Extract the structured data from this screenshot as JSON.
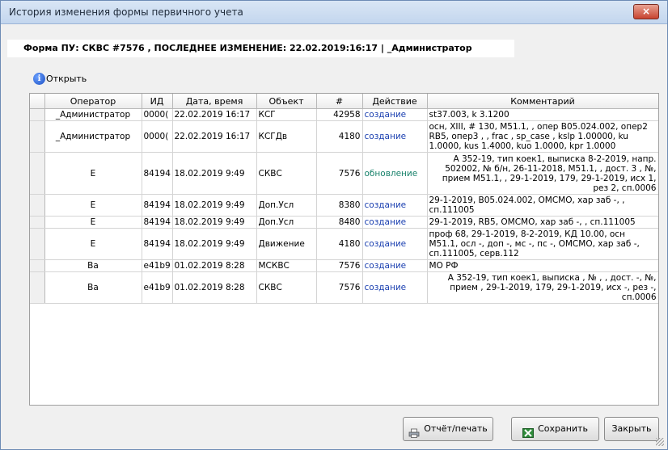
{
  "window": {
    "title": "История изменения формы первичного учета",
    "close_label": "×"
  },
  "form_header": "Форма ПУ: СКВС  #7576 , ПОСЛЕДНЕЕ ИЗМЕНЕНИЕ: 22.02.2019:16:17 | _Администратор",
  "toolbar": {
    "open_label": "Открыть",
    "open_icon": "info-icon"
  },
  "table": {
    "columns": [
      "",
      "Оператор",
      "ИД",
      "Дата, время",
      "Объект",
      "#",
      "Действие",
      "Комментарий"
    ],
    "rows": [
      {
        "operator": "_Администратор",
        "id": "0000(",
        "datetime": "22.02.2019 16:17",
        "object": "КСГ",
        "num": "42958",
        "action": "создание",
        "comment": "st37.003, k 3.1200"
      },
      {
        "operator": "_Администратор",
        "id": "0000(",
        "datetime": "22.02.2019 16:17",
        "object": "КСГДв",
        "num": "4180",
        "action": "создание",
        "comment": "осн, XIII, # 130, M51.1, , опер B05.024.002, опер2 RB5, опер3 , , frac , sp_case , kslp 1.00000, ku 1.0000, kus 1.4000, kuo 1.0000, kpr 1.0000"
      },
      {
        "operator": "Е",
        "id": "84194",
        "datetime": "18.02.2019 9:49",
        "object": "СКВС",
        "num": "7576",
        "action": "обновление",
        "comment": "А 352-19, тип коек1, выписка 8-2-2019, напр. 502002, № б/н, 26-11-2018, M51.1, , дост. 3 , №, прием M51.1, , 29-1-2019, 179, 29-1-2019, исх 1, рез 2, сп.0006"
      },
      {
        "operator": "Е",
        "id": "84194",
        "datetime": "18.02.2019 9:49",
        "object": "Доп.Усл",
        "num": "8380",
        "action": "создание",
        "comment": "29-1-2019, B05.024.002, ОМСМО, хар заб -, , сп.111005"
      },
      {
        "operator": "Е",
        "id": "84194",
        "datetime": "18.02.2019 9:49",
        "object": "Доп.Усл",
        "num": "8480",
        "action": "создание",
        "comment": "29-1-2019, RB5, ОМСМО, хар заб -, , сп.111005"
      },
      {
        "operator": "Е",
        "id": "84194",
        "datetime": "18.02.2019 9:49",
        "object": "Движение",
        "num": "4180",
        "action": "создание",
        "comment": "проф 68, 29-1-2019, 8-2-2019,  КД 10.00, осн M51.1, осл -, доп -, мс -, пс -, ОМСМО, хар заб -, сп.111005, серв.112"
      },
      {
        "operator": "Ва",
        "id": "e41b9",
        "datetime": "01.02.2019 8:28",
        "object": "МСКВС",
        "num": "7576",
        "action": "создание",
        "comment": "МО РФ"
      },
      {
        "operator": "Ва",
        "id": "e41b9",
        "datetime": "01.02.2019 8:28",
        "object": "СКВС",
        "num": "7576",
        "action": "создание",
        "comment": "А 352-19, тип коек1, выписка , № , , дост. -, №, прием , 29-1-2019, 179, 29-1-2019, исх -, рез -, сп.0006"
      }
    ]
  },
  "buttons": {
    "report": "Отчёт/печать",
    "save": "Сохранить",
    "close": "Закрыть"
  },
  "colors": {
    "action_create": "#1a3fb0",
    "action_update": "#18826b",
    "close_red": "#c8432f"
  }
}
